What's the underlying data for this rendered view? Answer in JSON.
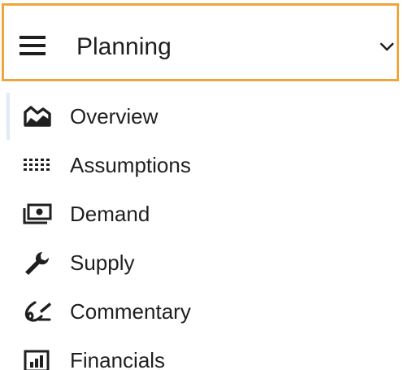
{
  "header": {
    "title": "Planning",
    "menu_icon": "hamburger-menu-icon",
    "expand_icon": "chevron-down-icon",
    "accent_color": "#f0a53c"
  },
  "nav": {
    "items": [
      {
        "label": "Overview",
        "icon": "area-chart-icon",
        "active": true
      },
      {
        "label": "Assumptions",
        "icon": "dot-grid-icon"
      },
      {
        "label": "Demand",
        "icon": "cash-stack-icon"
      },
      {
        "label": "Supply",
        "icon": "wrench-icon"
      },
      {
        "label": "Commentary",
        "icon": "signature-icon"
      },
      {
        "label": "Financials",
        "icon": "bar-chart-box-icon"
      }
    ]
  }
}
